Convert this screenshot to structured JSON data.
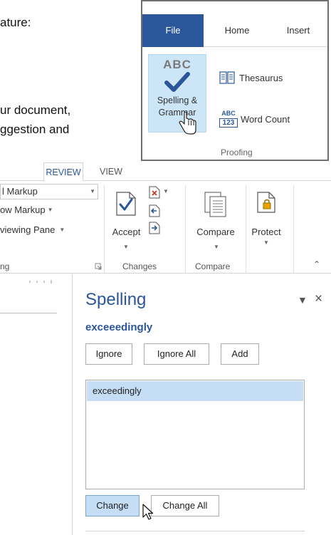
{
  "document": {
    "lines": [
      "ature:",
      "ur document,",
      "ggestion   and"
    ]
  },
  "proofing_inset": {
    "tabs": [
      "File",
      "Home",
      "Insert"
    ],
    "spelling_button": {
      "abc": "ABC",
      "label_line1": "Spelling &",
      "label_line2": "Grammar"
    },
    "thesaurus_label": "Thesaurus",
    "word_count": {
      "icon_top": "ABC",
      "icon_bottom": "123",
      "label": "Word Count"
    },
    "group_label": "Proofing"
  },
  "ribbon": {
    "tabs": {
      "review": "REVIEW",
      "view": "VIEW"
    },
    "tracking": {
      "markup_dropdown": "l Markup",
      "show_markup": "ow Markup",
      "reviewing_pane": "viewing Pane",
      "group_label": "ng"
    },
    "changes": {
      "accept_label": "Accept",
      "group_label": "Changes"
    },
    "compare": {
      "label": "Compare",
      "group_label": "Compare"
    },
    "protect": {
      "label": "Protect"
    }
  },
  "spelling_pane": {
    "title": "Spelling",
    "misspelled_word": "exceeedingly",
    "buttons": {
      "ignore": "Ignore",
      "ignore_all": "Ignore All",
      "add": "Add",
      "change": "Change",
      "change_all": "Change All"
    },
    "suggestions": [
      "exceedingly"
    ]
  },
  "colors": {
    "accent": "#2b579a",
    "highlight": "#c5ddf5",
    "file_tab": "#2b579a"
  }
}
